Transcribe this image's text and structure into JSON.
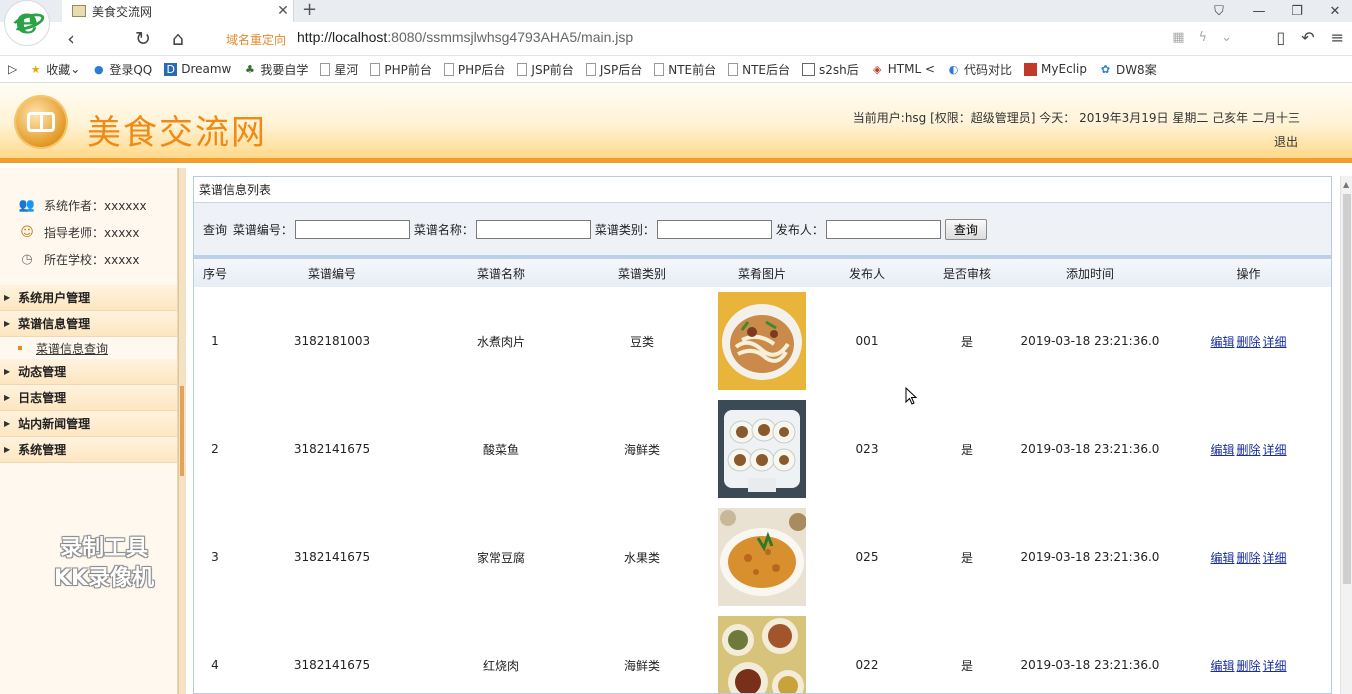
{
  "browser": {
    "tab_title": "美食交流网",
    "redirect_label": "域名重定向",
    "url_host": "http://localhost",
    "url_rest": ":8080/ssmmsjlwhsg4793AHA5/main.jsp",
    "bookmarks": [
      "收藏",
      "登录QQ",
      "Dreamw",
      "我要自学",
      "星河",
      "PHP前台",
      "PHP后台",
      "JSP前台",
      "JSP后台",
      "NTE前台",
      "NTE后台",
      "s2sh后",
      "HTML <",
      "代码对比",
      "MyEclip",
      "DW8案"
    ]
  },
  "header": {
    "site_title": "美食交流网",
    "user_info": "当前用户:hsg [权限：超级管理员] 今天： 2019年3月19日 星期二 己亥年 二月十三",
    "logout": "退出"
  },
  "sidebar": {
    "info": [
      {
        "label": "系统作者：xxxxxx",
        "icon": "users-icon"
      },
      {
        "label": "指导老师：xxxxx",
        "icon": "teacher-icon"
      },
      {
        "label": "所在学校：xxxxx",
        "icon": "clock-icon"
      }
    ],
    "menu": [
      "系统用户管理",
      "菜谱信息管理",
      "动态管理",
      "日志管理",
      "站内新闻管理",
      "系统管理"
    ],
    "submenu": "菜谱信息查询",
    "watermark_line1": "录制工具",
    "watermark_line2": "KK录像机"
  },
  "main": {
    "panel_title": "菜谱信息列表",
    "search": {
      "prefix": "查询",
      "field1": "菜谱编号：",
      "field2": "菜谱名称：",
      "field3": "菜谱类别：",
      "field4": "发布人：",
      "button": "查询"
    },
    "columns": [
      "序号",
      "菜谱编号",
      "菜谱名称",
      "菜谱类别",
      "菜肴图片",
      "发布人",
      "是否审核",
      "添加时间",
      "操作"
    ],
    "rows": [
      {
        "no": "1",
        "code": "3182181003",
        "name": "水煮肉片",
        "category": "豆类",
        "author": "001",
        "audited": "是",
        "time": "2019-03-18 23:21:36.0"
      },
      {
        "no": "2",
        "code": "3182141675",
        "name": "酸菜鱼",
        "category": "海鲜类",
        "author": "023",
        "audited": "是",
        "time": "2019-03-18 23:21:36.0"
      },
      {
        "no": "3",
        "code": "3182141675",
        "name": "家常豆腐",
        "category": "水果类",
        "author": "025",
        "audited": "是",
        "time": "2019-03-18 23:21:36.0"
      },
      {
        "no": "4",
        "code": "3182141675",
        "name": "红烧肉",
        "category": "海鲜类",
        "author": "022",
        "audited": "是",
        "time": "2019-03-18 23:21:36.0"
      }
    ],
    "ops": {
      "edit": "编辑",
      "delete": "删除",
      "detail": "详细"
    }
  }
}
